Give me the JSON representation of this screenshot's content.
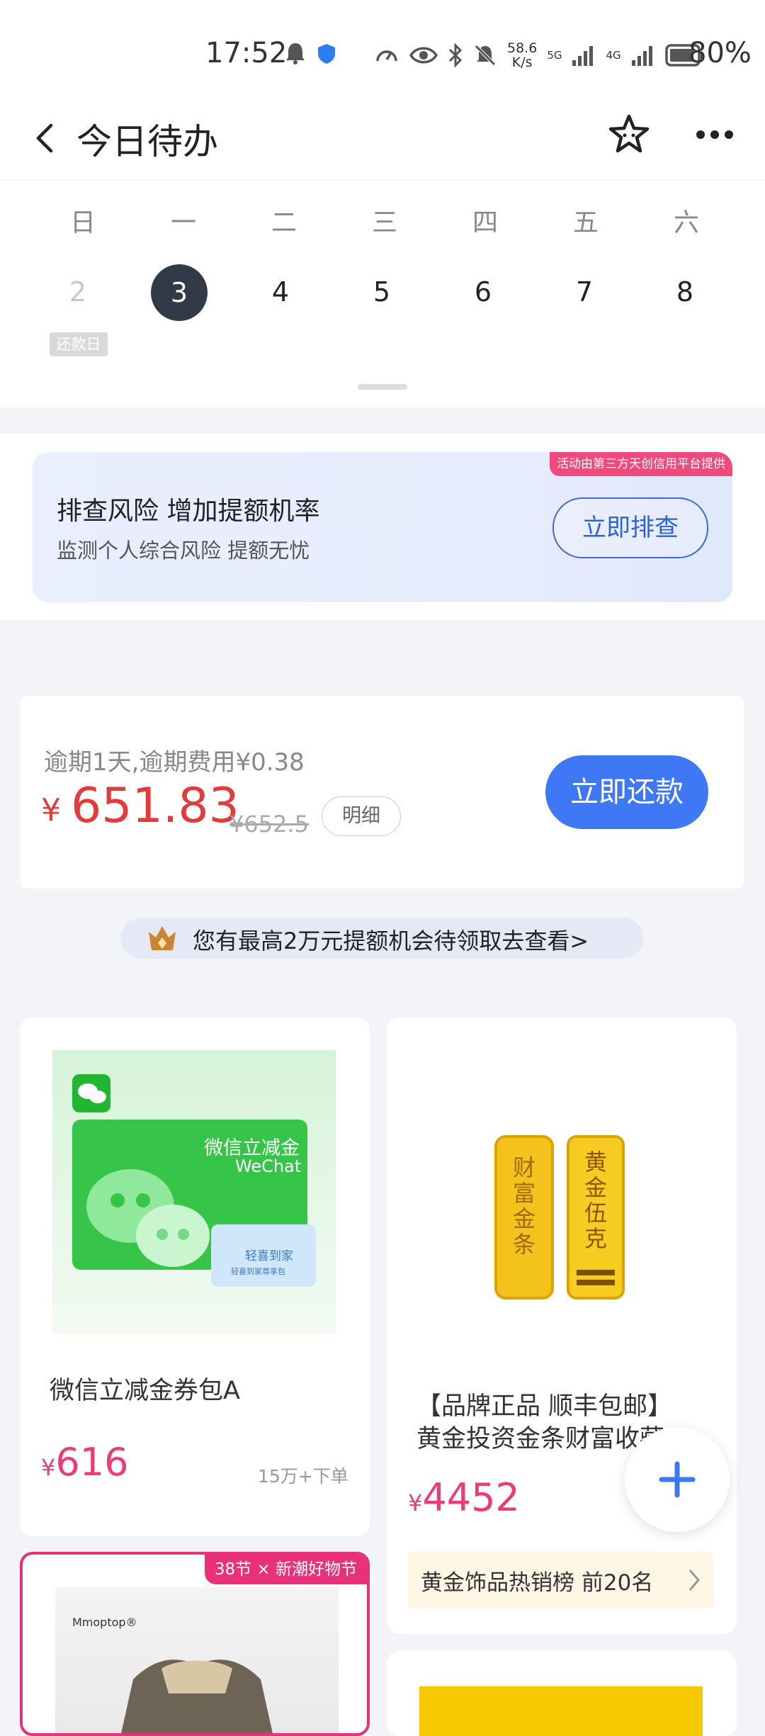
{
  "status_bar": {
    "time": "17:52",
    "speed_value": "58.6",
    "speed_unit": "K/s",
    "net1": "5G",
    "net2": "4G",
    "battery": "80%"
  },
  "header": {
    "title": "今日待办"
  },
  "calendar": {
    "weekdays": [
      "日",
      "一",
      "二",
      "三",
      "四",
      "五",
      "六"
    ],
    "dates": [
      "2",
      "3",
      "4",
      "5",
      "6",
      "7",
      "8"
    ],
    "selected_index": 1,
    "repay_tag": "还款日"
  },
  "promo": {
    "ribbon": "活动由第三方天创信用平台提供",
    "headline": "排查风险  增加提额机率",
    "subline": "监测个人综合风险  提额无忧",
    "cta": "立即排查"
  },
  "bill": {
    "overdue_text": "逾期1天,逾期费用¥0.38",
    "currency": "¥",
    "amount": "651.83",
    "original_amount": "¥652.5",
    "detail_label": "明细",
    "pay_label": "立即还款"
  },
  "credit_banner": {
    "text": "您有最高2万元提额机会待领取去查看>"
  },
  "products": {
    "p1": {
      "image_title": "微信立减金",
      "image_sub": "WeChat",
      "image_badge": "轻喜到家",
      "image_badge_sub": "轻喜到家尊享包",
      "name": "微信立减金券包A",
      "currency": "¥",
      "price": "616",
      "sold": "15万+下单"
    },
    "p2": {
      "bar1_text": "财富金条",
      "bar2_text": "黄金伍克",
      "name_line1": "【品牌正品 顺丰包邮】",
      "name_line2": "黄金投资金条财富收藏",
      "currency": "¥",
      "price": "4452",
      "rank_label": "黄金饰品热销榜 前20名"
    },
    "p3": {
      "ribbon": "38节 × 新潮好物节",
      "brand": "Mmoptop®"
    }
  },
  "colors": {
    "accent_blue": "#3f78f5",
    "price_red": "#e23b3b",
    "product_pink": "#ea3d78",
    "selected_date_bg": "#333a47"
  }
}
